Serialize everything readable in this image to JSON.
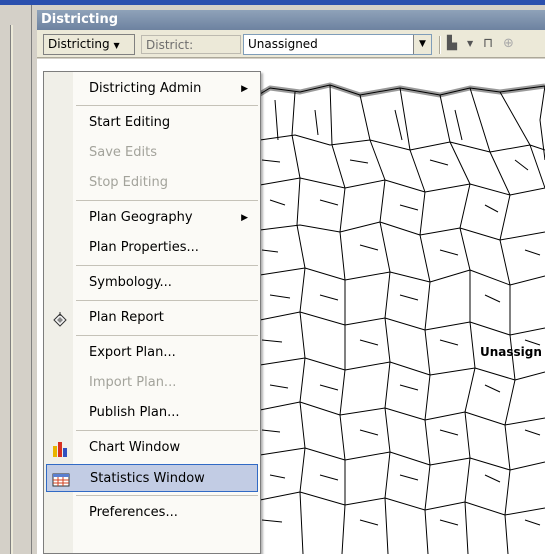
{
  "window": {
    "title": "Districting"
  },
  "toolbar": {
    "districting_button": "Districting",
    "district_label": "District:",
    "district_value": "Unassigned"
  },
  "map": {
    "label": "Unassign"
  },
  "menu": {
    "items": [
      {
        "label": "Districting Admin",
        "submenu": true,
        "enabled": true
      },
      {
        "label": "Start Editing",
        "enabled": true
      },
      {
        "label": "Save Edits",
        "enabled": false
      },
      {
        "label": "Stop Editing",
        "enabled": false
      },
      {
        "label": "Plan Geography",
        "submenu": true,
        "enabled": true
      },
      {
        "label": "Plan Properties...",
        "enabled": true
      },
      {
        "label": "Symbology...",
        "enabled": true
      },
      {
        "label": "Plan Report",
        "enabled": true,
        "icon": "report-icon"
      },
      {
        "label": "Export Plan...",
        "enabled": true
      },
      {
        "label": "Import Plan...",
        "enabled": false
      },
      {
        "label": "Publish Plan...",
        "enabled": true
      },
      {
        "label": "Chart Window",
        "enabled": true,
        "icon": "chart-icon"
      },
      {
        "label": "Statistics Window",
        "enabled": true,
        "icon": "table-icon",
        "highlighted": true
      },
      {
        "label": "Preferences...",
        "enabled": true
      }
    ]
  },
  "colors": {
    "title_bar": "#7b8fab",
    "highlight": "#c2cce4",
    "accent_strip": "#2a4fae"
  }
}
